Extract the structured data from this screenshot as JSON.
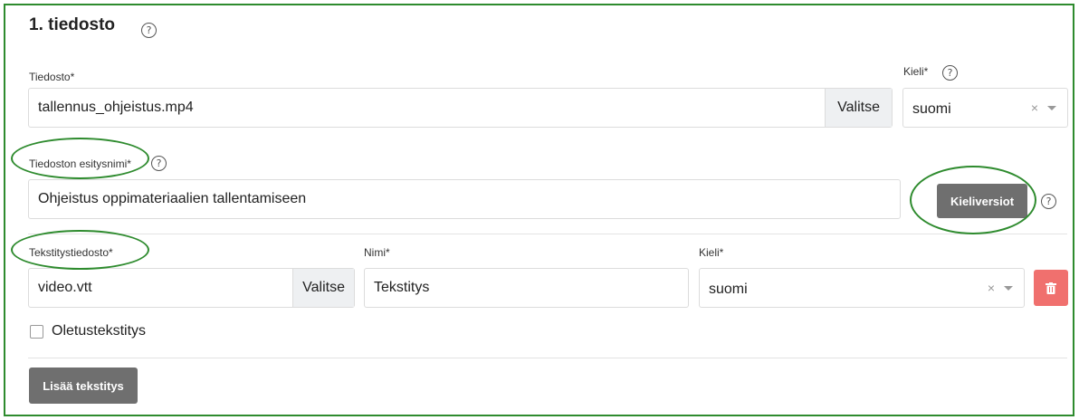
{
  "section": {
    "title": "1. tiedosto",
    "help_glyph": "?"
  },
  "file": {
    "label": "Tiedosto*",
    "value": "tallennus_ohjeistus.mp4",
    "choose_label": "Valitse"
  },
  "language": {
    "label": "Kieli*",
    "value": "suomi",
    "clear_glyph": "×"
  },
  "display_name": {
    "label": "Tiedoston esitysnimi*",
    "value": "Ohjeistus oppimateriaalien tallentamiseen",
    "language_versions_label": "Kieliversiot"
  },
  "subtitle": {
    "file_label": "Tekstitystiedosto*",
    "file_value": "video.vtt",
    "choose_label": "Valitse",
    "name_label": "Nimi*",
    "name_value": "Tekstitys",
    "language_label": "Kieli*",
    "language_value": "suomi",
    "clear_glyph": "×",
    "default_label": "Oletustekstitys"
  },
  "add_subtitle_label": "Lisää tekstitys",
  "colors": {
    "annotation_green": "#2e8b2e",
    "button_gray": "#6f6f6f",
    "delete_red": "#f0706e"
  }
}
